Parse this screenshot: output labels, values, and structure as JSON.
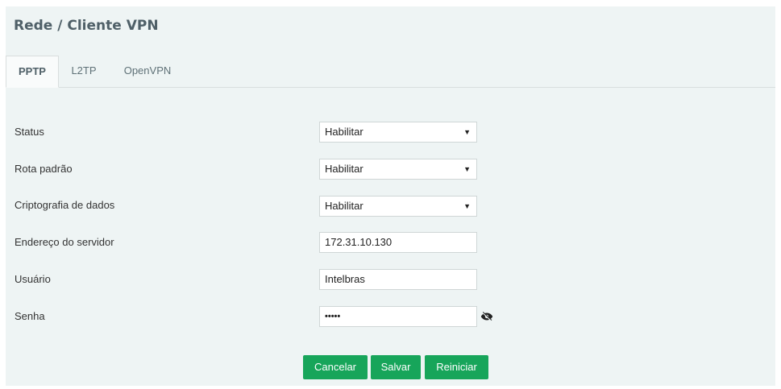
{
  "header": {
    "title": "Rede / Cliente VPN"
  },
  "tabs": [
    {
      "label": "PPTP"
    },
    {
      "label": "L2TP"
    },
    {
      "label": "OpenVPN"
    }
  ],
  "form": {
    "status": {
      "label": "Status",
      "value": "Habilitar"
    },
    "default_route": {
      "label": "Rota padrão",
      "value": "Habilitar"
    },
    "encryption": {
      "label": "Criptografia de dados",
      "value": "Habilitar"
    },
    "server": {
      "label": "Endereço do servidor",
      "value": "172.31.10.130"
    },
    "user": {
      "label": "Usuário",
      "value": "Intelbras"
    },
    "password": {
      "label": "Senha",
      "value": "•••••"
    }
  },
  "buttons": {
    "cancel": "Cancelar",
    "save": "Salvar",
    "restart": "Reiniciar"
  },
  "icons": {
    "password_toggle": "eye-slash-icon",
    "dropdown": "caret-down-icon"
  },
  "colors": {
    "accent": "#17a55a",
    "panel": "#eef4f4",
    "title": "#4f6068"
  }
}
